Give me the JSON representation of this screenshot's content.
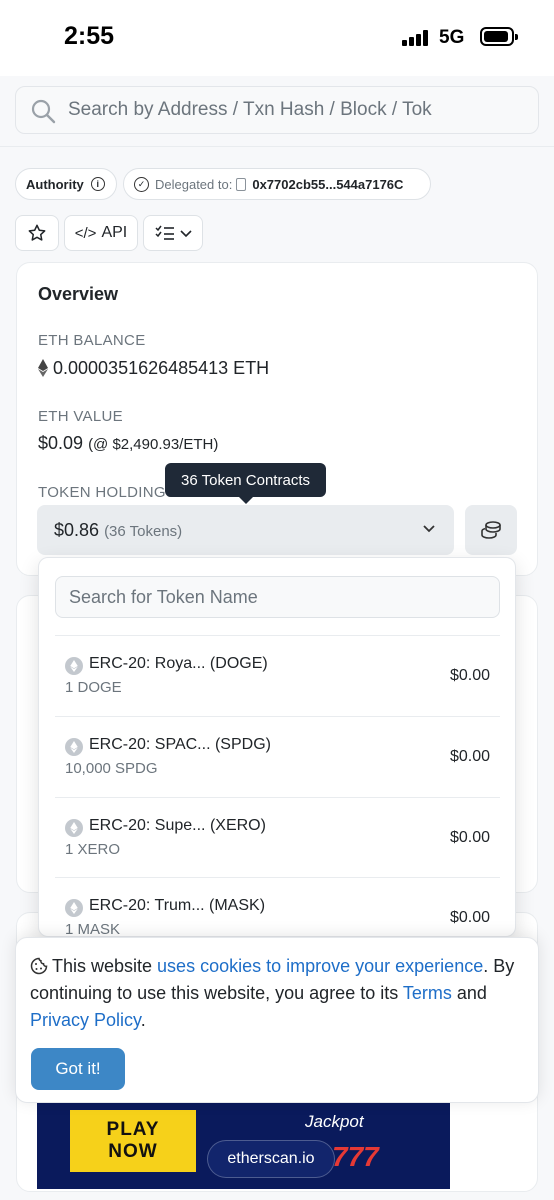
{
  "status_bar": {
    "time": "2:55",
    "network": "5G"
  },
  "search": {
    "placeholder": "Search by Address / Txn Hash / Block / Tok"
  },
  "address_tags": {
    "authority_label": "Authority",
    "delegated_label": "Delegated to:",
    "delegated_address": "0x7702cb55...544a7176C"
  },
  "actions": {
    "api_label": "API"
  },
  "overview": {
    "title": "Overview",
    "eth_balance_label": "ETH BALANCE",
    "eth_balance_value": "0.0000351626485413 ETH",
    "eth_value_label": "ETH VALUE",
    "eth_value_amount": "$0.09",
    "eth_value_rate": "(@ $2,490.93/ETH)",
    "token_holdings_label": "TOKEN HOLDINGS",
    "token_holdings_tooltip": "36 Token Contracts",
    "token_holdings_value": "$0.86",
    "token_holdings_count": "(36 Tokens)"
  },
  "token_dropdown": {
    "search_placeholder": "Search for Token Name",
    "tokens": [
      {
        "name": "ERC-20: Roya... (DOGE)",
        "amount": "1 DOGE",
        "value": "$0.00"
      },
      {
        "name": "ERC-20: SPAC... (SPDG)",
        "amount": "10,000 SPDG",
        "value": "$0.00"
      },
      {
        "name": "ERC-20: Supe... (XERO)",
        "amount": "1 XERO",
        "value": "$0.00"
      },
      {
        "name": "ERC-20: Trum... (MASK)",
        "amount": "1 MASK",
        "value": "$0.00"
      }
    ]
  },
  "cookie_banner": {
    "text_1": "This website ",
    "link_1": "uses cookies to improve your experience",
    "text_2": ". By continuing to use this website, you agree to its ",
    "link_2": "Terms",
    "text_3": " and ",
    "link_3": "Privacy Policy",
    "text_4": ".",
    "button": "Got it!"
  },
  "ad": {
    "cta_line1": "PLAY",
    "cta_line2": "NOW",
    "jackpot": "Jackpot",
    "brand": "etherscan.io",
    "sevens": "777"
  },
  "colors": {
    "link": "#1e6ec8",
    "primary_button": "#3d87c6",
    "tooltip_bg": "#1f2937"
  }
}
